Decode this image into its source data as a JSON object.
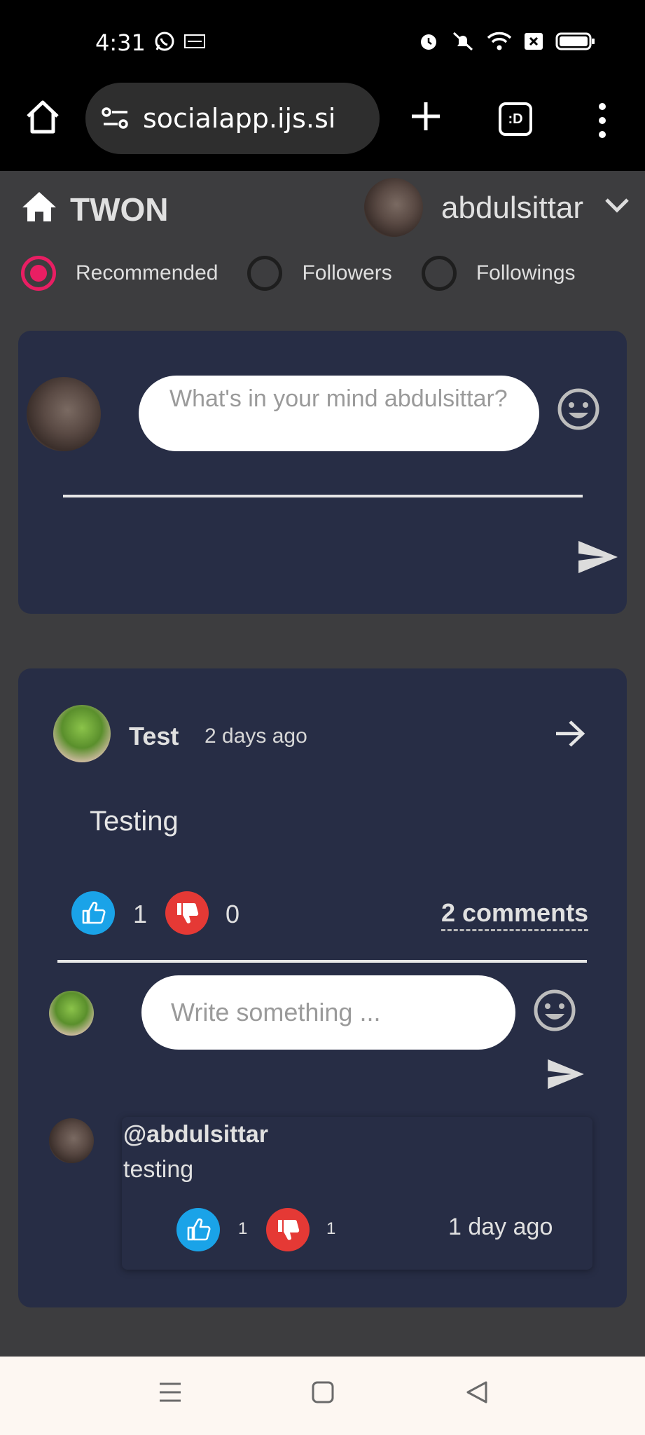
{
  "status_bar": {
    "time": "4:31",
    "left_icons": [
      "whatsapp-icon",
      "temu-icon"
    ],
    "right_icons": [
      "alarm-icon",
      "mute-icon",
      "wifi-icon",
      "sim-icon",
      "battery-icon"
    ]
  },
  "browser": {
    "url": "socialapp.ijs.si",
    "tabs_label": ":D"
  },
  "header": {
    "app_title": "TWON",
    "username": "abdulsittar"
  },
  "filters": [
    {
      "label": "Recommended",
      "checked": true
    },
    {
      "label": "Followers",
      "checked": false
    },
    {
      "label": "Followings",
      "checked": false
    }
  ],
  "composer": {
    "placeholder": "What's in your mind abdulsittar?"
  },
  "post": {
    "author": "Test",
    "time": "2 days ago",
    "body": "Testing",
    "likes": "1",
    "dislikes": "0",
    "comments_link": "2 comments",
    "reply_placeholder": "Write something ..."
  },
  "comment": {
    "handle": "@abdulsittar",
    "text": "testing",
    "likes": "1",
    "dislikes": "1",
    "time": "1 day ago"
  },
  "colors": {
    "accent_radio": "#e91e63",
    "card_bg": "#272d45",
    "page_bg": "#3d3d3f",
    "like": "#1aa3e8",
    "dislike": "#e53935"
  }
}
